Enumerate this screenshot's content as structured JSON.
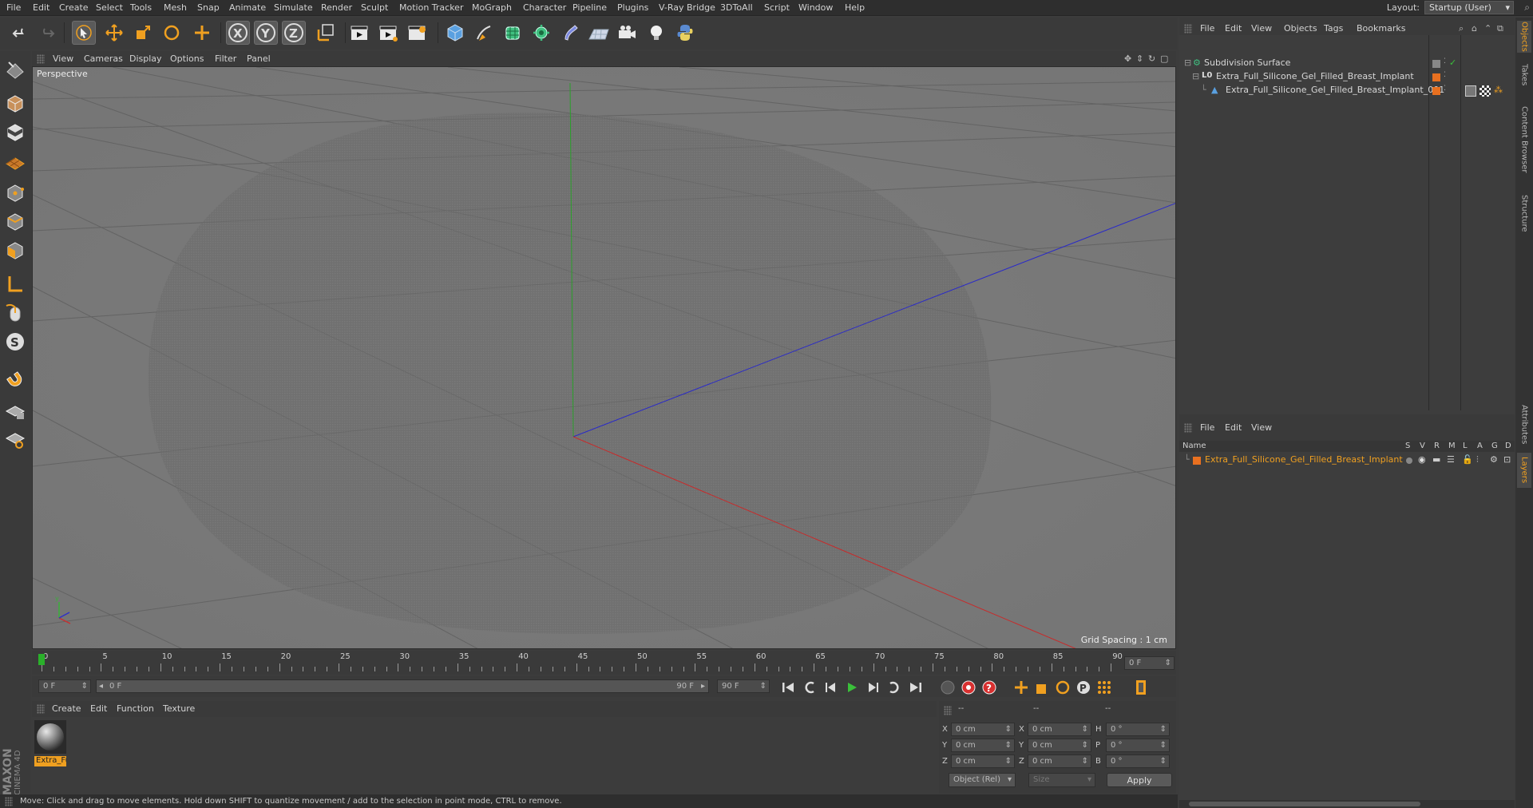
{
  "menubar": {
    "items": [
      "File",
      "Edit",
      "Create",
      "Select",
      "Tools",
      "Mesh",
      "Snap",
      "Animate",
      "Simulate",
      "Render",
      "Sculpt",
      "Motion Tracker",
      "MoGraph",
      "Character",
      "Pipeline",
      "Plugins",
      "V-Ray Bridge",
      "3DToAll",
      "Script",
      "Window",
      "Help"
    ],
    "layout_label": "Layout:",
    "layout_value": "Startup (User)"
  },
  "viewport": {
    "menu": [
      "View",
      "Cameras",
      "Display",
      "Options",
      "Filter",
      "Panel"
    ],
    "label": "Perspective",
    "grid_spacing": "Grid Spacing : 1 cm"
  },
  "timeline": {
    "ticks": [
      "0",
      "5",
      "10",
      "15",
      "20",
      "25",
      "30",
      "35",
      "40",
      "45",
      "50",
      "55",
      "60",
      "65",
      "70",
      "75",
      "80",
      "85",
      "90"
    ],
    "current_frame_field": "0 F",
    "start_field": "0 F",
    "range_start": "0 F",
    "range_end": "90 F",
    "end_field": "90 F"
  },
  "material_manager": {
    "menu": [
      "Create",
      "Edit",
      "Function",
      "Texture"
    ],
    "materials": [
      {
        "name": "Extra_Fu"
      }
    ]
  },
  "coordinates": {
    "header": [
      "--",
      "--",
      "--"
    ],
    "rows": [
      {
        "a": "X",
        "a_val": "0 cm",
        "b": "X",
        "b_val": "0 cm",
        "c": "H",
        "c_val": "0 °"
      },
      {
        "a": "Y",
        "a_val": "0 cm",
        "b": "Y",
        "b_val": "0 cm",
        "c": "P",
        "c_val": "0 °"
      },
      {
        "a": "Z",
        "a_val": "0 cm",
        "b": "Z",
        "b_val": "0 cm",
        "c": "B",
        "c_val": "0 °"
      }
    ],
    "mode": "Object (Rel)",
    "size": "Size",
    "apply": "Apply"
  },
  "object_manager": {
    "menu": [
      "File",
      "Edit",
      "View",
      "Objects",
      "Tags",
      "Bookmarks"
    ],
    "objects": [
      {
        "name": "Subdivision Surface"
      },
      {
        "name": "Extra_Full_Silicone_Gel_Filled_Breast_Implant"
      },
      {
        "name": "Extra_Full_Silicone_Gel_Filled_Breast_Implant_001"
      }
    ]
  },
  "layer_manager": {
    "menu": [
      "File",
      "Edit",
      "View"
    ],
    "columns": [
      "Name",
      "S",
      "V",
      "R",
      "M",
      "L",
      "A",
      "G",
      "D"
    ],
    "layers": [
      {
        "name": "Extra_Full_Silicone_Gel_Filled_Breast_Implant",
        "color": "#e87020"
      }
    ]
  },
  "side_tabs": [
    "Objects",
    "Takes",
    "Content Browser",
    "Structure",
    "Attributes",
    "Layers"
  ],
  "status": "Move: Click and drag to move elements. Hold down SHIFT to quantize movement / add to the selection in point mode, CTRL to remove.",
  "brand": {
    "maxon": "MAXON",
    "cinema": "CINEMA 4D"
  },
  "colors": {
    "accent_orange": "#f0a020",
    "axis_x": "#c02020",
    "axis_y": "#20a020",
    "axis_z": "#2020c0",
    "layer_orange": "#e87020"
  }
}
